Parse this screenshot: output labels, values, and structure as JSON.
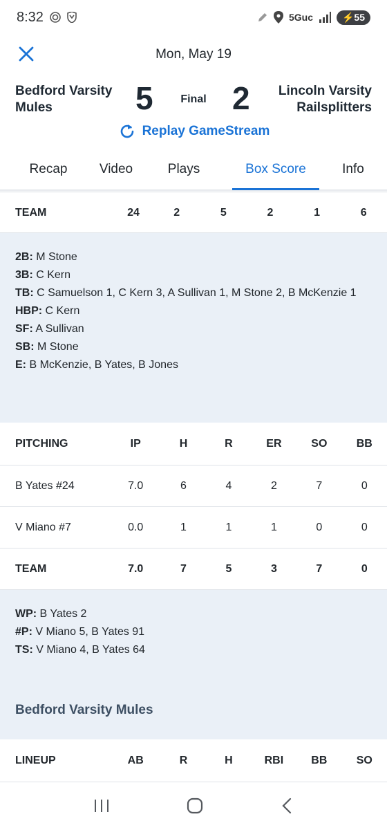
{
  "status": {
    "time": "8:32",
    "network": "5Guc",
    "battery": "55"
  },
  "header": {
    "date": "Mon, May 19",
    "home_team_line1": "Bedford Varsity",
    "home_team_line2": "Mules",
    "home_score": "5",
    "status": "Final",
    "away_score": "2",
    "away_team_line1": "Lincoln Varsity",
    "away_team_line2": "Railsplitters",
    "replay_label": "Replay GameStream"
  },
  "tabs": [
    {
      "label": "Recap"
    },
    {
      "label": "Video"
    },
    {
      "label": "Plays"
    },
    {
      "label": "Box Score"
    },
    {
      "label": "Info"
    }
  ],
  "batting_team_row": {
    "label": "TEAM",
    "values": [
      "24",
      "2",
      "5",
      "2",
      "1",
      "6"
    ]
  },
  "batting_notes": [
    {
      "label": "2B:",
      "text": " M Stone"
    },
    {
      "label": "3B:",
      "text": " C Kern"
    },
    {
      "label": "TB:",
      "text": " C Samuelson 1, C Kern 3, A Sullivan 1, M Stone 2, B McKenzie 1"
    },
    {
      "label": "HBP:",
      "text": " C Kern"
    },
    {
      "label": "SF:",
      "text": " A Sullivan"
    },
    {
      "label": "SB:",
      "text": " M Stone"
    },
    {
      "label": "E:",
      "text": " B McKenzie, B Yates, B Jones"
    }
  ],
  "pitching": {
    "headers": [
      "PITCHING",
      "IP",
      "H",
      "R",
      "ER",
      "SO",
      "BB"
    ],
    "rows": [
      [
        "B Yates #24",
        "7.0",
        "6",
        "4",
        "2",
        "7",
        "0"
      ],
      [
        "V Miano #7",
        "0.0",
        "1",
        "1",
        "1",
        "0",
        "0"
      ]
    ],
    "team": [
      "TEAM",
      "7.0",
      "7",
      "5",
      "3",
      "7",
      "0"
    ]
  },
  "pitching_notes": [
    {
      "label": "WP:",
      "text": " B Yates 2"
    },
    {
      "label": "#P:",
      "text": " V Miano 5, B Yates 91"
    },
    {
      "label": "TS:",
      "text": " V Miano 4, B Yates 64"
    }
  ],
  "lineup_section": {
    "title": "Bedford Varsity Mules",
    "headers": [
      "LINEUP",
      "AB",
      "R",
      "H",
      "RBI",
      "BB",
      "SO"
    ]
  },
  "colors": {
    "accent": "#1a73d6",
    "notes_bg": "#eaf0f7"
  }
}
